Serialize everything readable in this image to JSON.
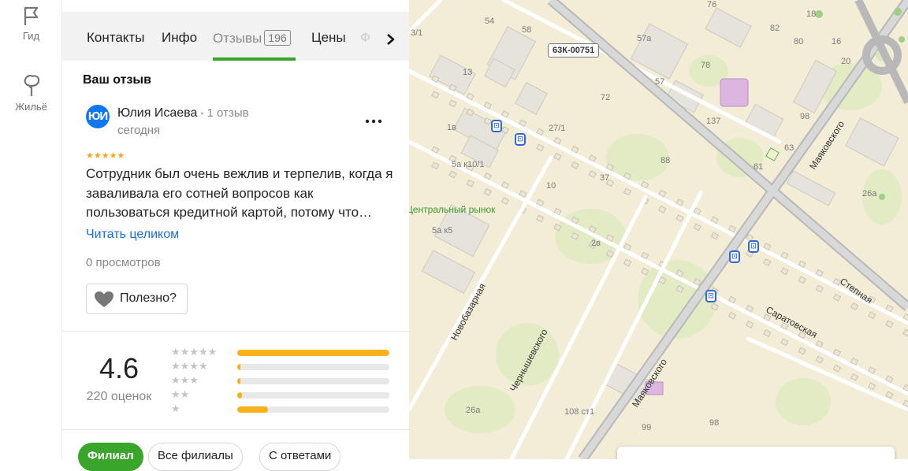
{
  "rail": {
    "guide_label": "Гид",
    "housing_label": "Жильё"
  },
  "tabs": [
    {
      "label": "Контакты"
    },
    {
      "label": "Инфо"
    },
    {
      "label": "Отзывы",
      "count": "196",
      "active": true
    },
    {
      "label": "Цены"
    },
    {
      "label": "Ф"
    }
  ],
  "review": {
    "section_title": "Ваш отзыв",
    "avatar_initials": "ЮИ",
    "author": "Юлия Исаева",
    "author_reviews": "1 отзыв",
    "date": "сегодня",
    "stars": "★★★★★",
    "text": "Сотрудник был очень вежлив и терпелив, когда я заваливала его сотней вопросов как пользоваться кредитной картой, потому что…",
    "read_more": "Читать целиком",
    "views": "0 просмотров",
    "useful_label": "Полезно?"
  },
  "rating": {
    "value": "4.6",
    "count_label": "220 оценок",
    "histogram": [
      {
        "stars": "★★★★★",
        "fraction": 1.0
      },
      {
        "stars": "★★★★",
        "fraction": 0.02
      },
      {
        "stars": "★★★",
        "fraction": 0.02
      },
      {
        "stars": "★★",
        "fraction": 0.03
      },
      {
        "stars": "★",
        "fraction": 0.2
      }
    ]
  },
  "filters": [
    {
      "label": "Филиал",
      "active": true
    },
    {
      "label": "Все филиалы",
      "active": false
    },
    {
      "label": "С ответами",
      "active": false
    }
  ],
  "map": {
    "road_badge": "63К-00751",
    "market_label": "Центральный рынок",
    "streets": [
      "Маяковского",
      "Маяковского",
      "Степная",
      "Саратовская",
      "Новобазарная",
      "Чернышевского"
    ],
    "house_numbers": [
      "54",
      "58",
      "3/1",
      "13",
      "72",
      "57а",
      "57",
      "78",
      "76",
      "82",
      "80",
      "18",
      "16",
      "20",
      "98",
      "137",
      "63",
      "61",
      "26а",
      "88",
      "37",
      "27/1",
      "1в",
      "5а к10/1",
      "10",
      "5а к5",
      "2в",
      "26а",
      "108 ст1",
      "99",
      "98"
    ]
  },
  "colors": {
    "accent_green": "#3aa52b",
    "star_yellow": "#f7b21b",
    "link_blue": "#1a6fd1",
    "avatar_blue": "#1177ee"
  }
}
